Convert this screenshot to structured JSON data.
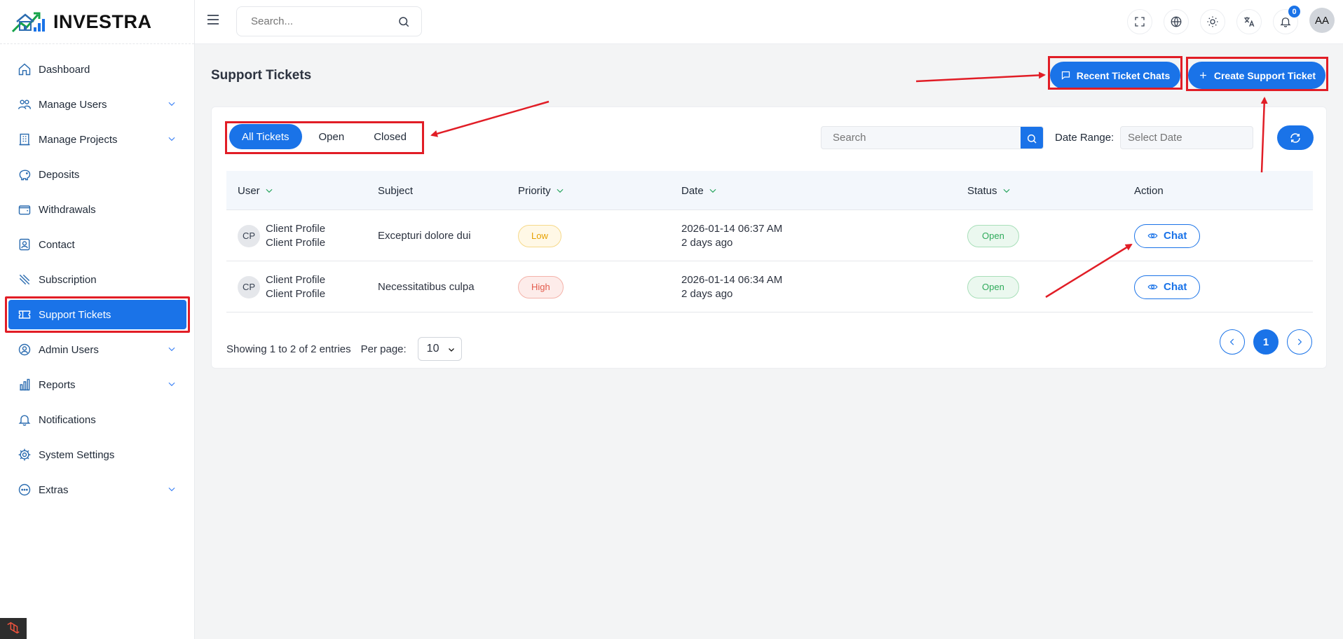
{
  "brand": {
    "name": "INVESTRA"
  },
  "topbar": {
    "search_placeholder": "Search...",
    "notification_count": "0",
    "avatar_initials": "AA"
  },
  "sidebar": {
    "items": [
      {
        "label": "Dashboard",
        "icon": "home-icon",
        "has_chevron": false
      },
      {
        "label": "Manage Users",
        "icon": "users-icon",
        "has_chevron": true
      },
      {
        "label": "Manage Projects",
        "icon": "building-icon",
        "has_chevron": true
      },
      {
        "label": "Deposits",
        "icon": "piggy-bank-icon",
        "has_chevron": false
      },
      {
        "label": "Withdrawals",
        "icon": "wallet-icon",
        "has_chevron": false
      },
      {
        "label": "Contact",
        "icon": "contact-icon",
        "has_chevron": false
      },
      {
        "label": "Subscription",
        "icon": "subscription-icon",
        "has_chevron": false
      },
      {
        "label": "Support Tickets",
        "icon": "ticket-icon",
        "has_chevron": false,
        "active": true
      },
      {
        "label": "Admin Users",
        "icon": "admin-user-icon",
        "has_chevron": true
      },
      {
        "label": "Reports",
        "icon": "chart-bar-icon",
        "has_chevron": true
      },
      {
        "label": "Notifications",
        "icon": "bell-icon",
        "has_chevron": false
      },
      {
        "label": "System Settings",
        "icon": "gear-icon",
        "has_chevron": false
      },
      {
        "label": "Extras",
        "icon": "more-circle-icon",
        "has_chevron": true
      }
    ]
  },
  "page": {
    "title": "Support Tickets",
    "recent_chats_label": "Recent Ticket Chats",
    "create_ticket_label": "Create Support Ticket"
  },
  "filters": {
    "tabs": [
      {
        "label": "All Tickets",
        "active": true
      },
      {
        "label": "Open",
        "active": false
      },
      {
        "label": "Closed",
        "active": false
      }
    ],
    "search_placeholder": "Search",
    "date_range_label": "Date Range:",
    "date_placeholder": "Select Date"
  },
  "table": {
    "headers": {
      "user": "User",
      "subject": "Subject",
      "priority": "Priority",
      "date": "Date",
      "status": "Status",
      "action": "Action"
    },
    "rows": [
      {
        "initials": "CP",
        "user_line1": "Client Profile",
        "user_line2": "Client Profile",
        "subject": "Excepturi dolore dui",
        "priority": "Low",
        "date": "2026-01-14 06:37 AM",
        "ago": "2 days ago",
        "status": "Open",
        "action": "Chat"
      },
      {
        "initials": "CP",
        "user_line1": "Client Profile",
        "user_line2": "Client Profile",
        "subject": "Necessitatibus culpa",
        "priority": "High",
        "date": "2026-01-14 06:34 AM",
        "ago": "2 days ago",
        "status": "Open",
        "action": "Chat"
      }
    ]
  },
  "footer": {
    "showing": "Showing 1 to 2 of 2 entries",
    "per_page_label": "Per page:",
    "per_page_value": "10",
    "current_page": "1"
  },
  "colors": {
    "primary": "#1a73e8",
    "annotation": "#e11d26",
    "success": "#2faa5b",
    "warning": "#e6a100",
    "danger": "#e35b4c"
  }
}
